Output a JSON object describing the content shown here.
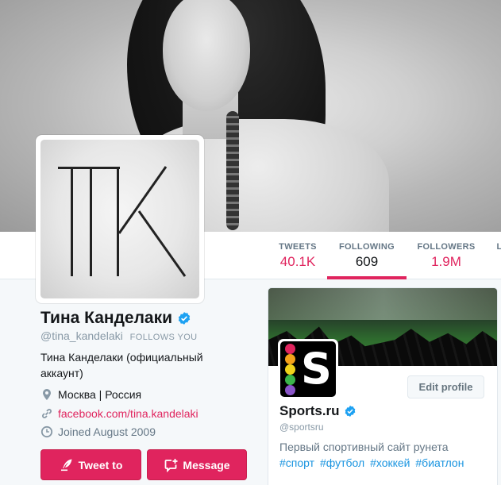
{
  "profile": {
    "name": "Тина Канделаки",
    "handle": "@tina_kandelaki",
    "follows_you": "FOLLOWS YOU",
    "bio": "Тина Канделаки (официальный аккаунт)",
    "location": "Москва | Россия",
    "url": "facebook.com/tina.kandelaki",
    "joined": "Joined August 2009",
    "avatar_letters": "TK"
  },
  "stats": [
    {
      "label": "TWEETS",
      "value": "40.1K"
    },
    {
      "label": "FOLLOWING",
      "value": "609"
    },
    {
      "label": "FOLLOWERS",
      "value": "1.9M"
    },
    {
      "label": "L",
      "value": ""
    }
  ],
  "actions": {
    "tweet_to": "Tweet to",
    "message": "Message"
  },
  "card": {
    "name": "Sports.ru",
    "handle": "@sportsru",
    "bio": "Первый спортивный сайт рунета",
    "tags": [
      "#спорт",
      "#футбол",
      "#хоккей",
      "#биатлон"
    ],
    "edit_profile": "Edit profile",
    "logo_letter": "S"
  },
  "colors": {
    "accent": "#e0245e",
    "link_blue": "#1b95e0",
    "verified": "#1da1f2",
    "logo_dots": [
      "#e0245e",
      "#f4a21a",
      "#f0d21a",
      "#3bb54a",
      "#1da1f2",
      "#8a55c9"
    ]
  },
  "icons": [
    "verified-icon",
    "location-icon",
    "link-icon",
    "calendar-icon",
    "quill-icon",
    "message-icon"
  ]
}
